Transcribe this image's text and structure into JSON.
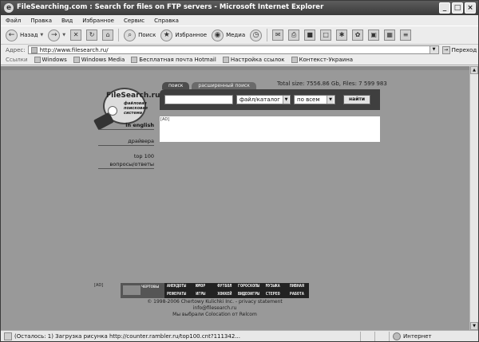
{
  "window": {
    "title": "FileSearching.com : Search for files on FTP servers - Microsoft Internet Explorer",
    "min_glyph": "_",
    "max_glyph": "□",
    "close_glyph": "×",
    "ie_glyph": "e"
  },
  "menu": [
    "Файл",
    "Правка",
    "Вид",
    "Избранное",
    "Сервис",
    "Справка"
  ],
  "toolbar": {
    "back_label": "Назад",
    "search_label": "Поиск",
    "favorites_label": "Избранное",
    "media_label": "Медиа",
    "glyphs": {
      "back": "←",
      "forward": "→",
      "stop": "✕",
      "refresh": "↻",
      "home": "⌂",
      "search": "⌕",
      "favorites": "★",
      "media": "◉",
      "history": "◷",
      "mail": "✉",
      "print": "⎙",
      "edit": "■",
      "discuss": "□",
      "t1": "✱",
      "t2": "✿",
      "t3": "▣",
      "t4": "▦",
      "t5": "≡",
      "dropdown": "▼"
    }
  },
  "address": {
    "label": "Адрес:",
    "url": "http://www.filesearch.ru/",
    "go_label": "Переход",
    "go_glyph": "→",
    "dropdown_glyph": "▼"
  },
  "links": {
    "label": "Ссылки",
    "items": [
      "Windows",
      "Windows Media",
      "Бесплатная почта Hotmail",
      "Настройка ссылок",
      "Контекст-Украина"
    ]
  },
  "page": {
    "logo": {
      "brand": "FileSearch.ru",
      "tag_line1": "файловая",
      "tag_line2": "поисковая",
      "tag_line3": "система"
    },
    "total_size": "Total size: 7556.86 Gb, Files: 7 599 983",
    "tabs": [
      "поиск",
      "расширенный поиск"
    ],
    "search": {
      "value": "",
      "type_select": "файл/каталог",
      "scope_select": "по всем",
      "submit": "найти",
      "dropdown_glyph": "▼"
    },
    "ad_top": "[AD]",
    "nav": [
      "in english",
      "драйвера",
      "top 100",
      "вопросы/ответы"
    ],
    "ad_bottom": "[AD]",
    "banner": {
      "left_text": "ЧЕРТОВЫ",
      "cells": [
        "АНЕКДОТЫ",
        "ЮМОР",
        "ФУТБОЛ",
        "ГОРОСКОПЫ",
        "МУЗЫКА",
        "ПИВНАЯ",
        "РЕФЕРАТЫ",
        "ИГРЫ",
        "ХОККЕЙ",
        "ВИДЕОИГРЫ",
        "СТЕРЕО",
        "РАБОТА"
      ]
    },
    "footer": {
      "copyright": "© 1998-2006 Chertowy Kulichki Inc. - privacy statement",
      "email": "info@filesearch.ru",
      "hosting": "Мы выбрали Colocation от Relcom"
    }
  },
  "scroll": {
    "up_glyph": "▲",
    "down_glyph": "▼"
  },
  "status": {
    "text": "(Осталось: 1) Загрузка рисунка http://counter.rambler.ru/top100.cnt?111342...",
    "zone": "Интернет"
  }
}
